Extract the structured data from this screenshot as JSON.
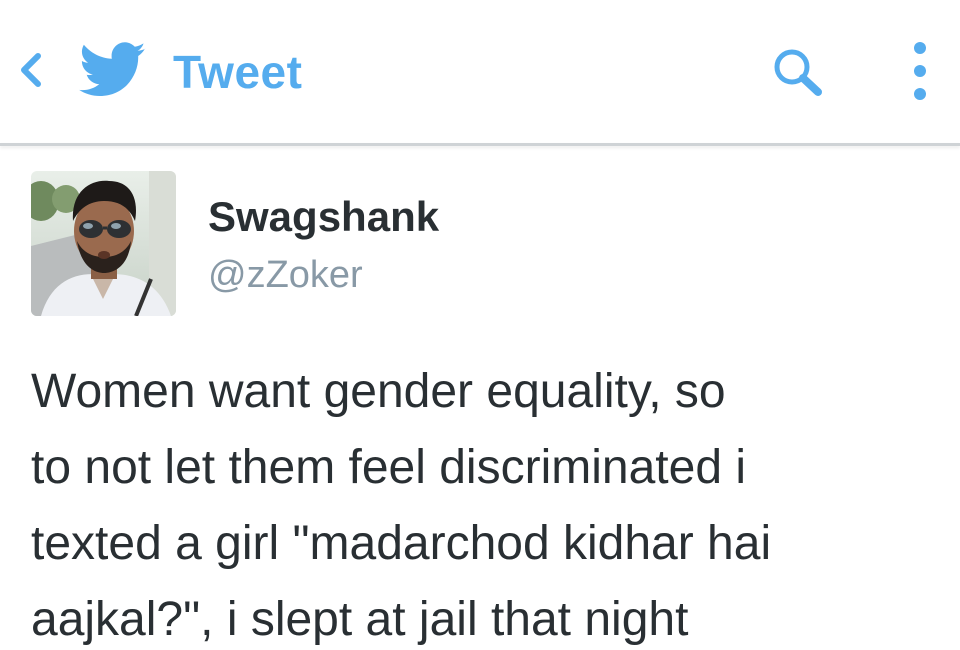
{
  "colors": {
    "accent": "#55acee",
    "name_text": "#292f33",
    "handle_text": "#8899a6",
    "body_text": "#292f33",
    "divider": "#cfd3d6"
  },
  "topbar": {
    "back_icon": "chevron-left-icon",
    "logo_icon": "twitter-bird-icon",
    "title": "Tweet",
    "search_icon": "search-icon",
    "overflow_icon": "more-vertical-icon"
  },
  "tweet": {
    "author_name": "Swagshank",
    "author_handle": "@zZoker",
    "text": "Women want gender equality, so\nto not let them feel discriminated i\ntexted a girl \"madarchod kidhar hai\naajkal?\", i slept at jail that night"
  }
}
